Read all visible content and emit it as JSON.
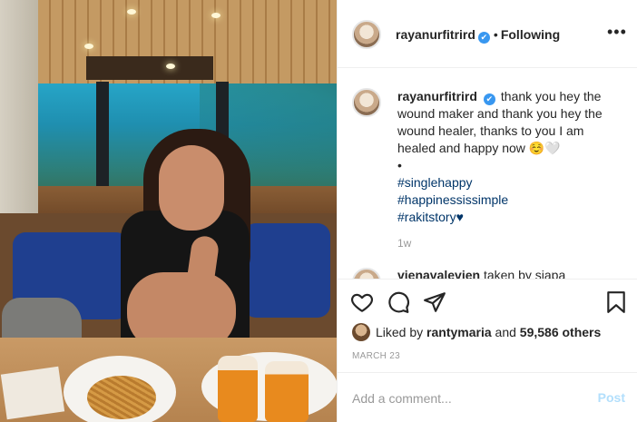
{
  "post": {
    "username": "rayanurfitrird",
    "verified_mark": "✔",
    "separator": "•",
    "follow_state": "Following",
    "more_label": "•••",
    "caption": {
      "username": "rayanurfitrird",
      "text": "thank you hey the wound maker and thank you hey the wound healer, thanks to you I am healed and happy now ☺️🤍",
      "bullet": "•",
      "hashtags": [
        "#singlehappy",
        "#happinessissimple",
        "#rakitstory♥"
      ],
      "time": "1w"
    },
    "second_comment": {
      "username": "vienavalevien",
      "text": "taken by siapa"
    },
    "likes": {
      "prefix": "Liked by",
      "user": "rantymaria",
      "joiner": "and",
      "count": "59,586 others"
    },
    "date": "MARCH 23",
    "comment_placeholder": "Add a comment...",
    "post_button": "Post"
  },
  "icons": [
    "heart-icon",
    "comment-icon",
    "share-icon",
    "bookmark-icon",
    "more-icon",
    "verified-icon"
  ],
  "colors": {
    "link": "#003569",
    "verified": "#3897f0",
    "muted": "#999999",
    "post_disabled": "#b2dffc"
  }
}
